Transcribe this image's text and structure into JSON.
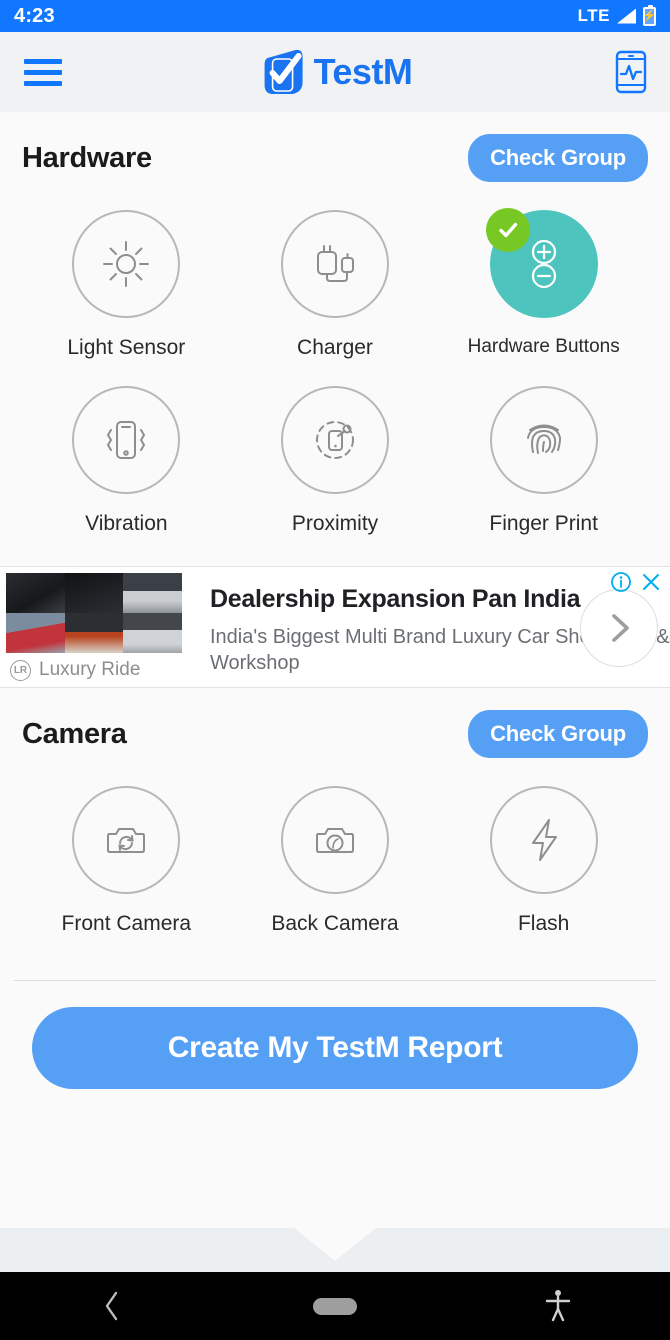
{
  "status_bar": {
    "time": "4:23",
    "network": "LTE",
    "signal_icon": "signal-bars-icon",
    "battery_icon": "battery-charging-icon",
    "background_color": "#1177ff"
  },
  "app_bar": {
    "menu_icon": "hamburger-menu-icon",
    "brand_name": "TestM",
    "brand_color": "#1a73f0",
    "logo_icon": "testm-logo-icon",
    "right_icon": "phone-pulse-icon"
  },
  "sections": [
    {
      "title": "Hardware",
      "action_label": "Check Group",
      "tiles": [
        {
          "label": "Light Sensor",
          "icon": "sun-light-sensor-icon",
          "state": "untested"
        },
        {
          "label": "Charger",
          "icon": "charger-plug-icon",
          "state": "untested"
        },
        {
          "label": "Hardware Buttons",
          "icon": "volume-buttons-icon",
          "state": "passed"
        },
        {
          "label": "Vibration",
          "icon": "phone-vibration-icon",
          "state": "untested"
        },
        {
          "label": "Proximity",
          "icon": "proximity-sensor-icon",
          "state": "untested"
        },
        {
          "label": "Finger Print",
          "icon": "fingerprint-icon",
          "state": "untested"
        }
      ]
    },
    {
      "title": "Camera",
      "action_label": "Check Group",
      "tiles": [
        {
          "label": "Front Camera",
          "icon": "camera-rotate-icon",
          "state": "untested"
        },
        {
          "label": "Back Camera",
          "icon": "camera-icon",
          "state": "untested"
        },
        {
          "label": "Flash",
          "icon": "flash-bolt-icon",
          "state": "untested"
        }
      ]
    }
  ],
  "advertisement": {
    "headline": "Dealership Expansion Pan India",
    "description": "India's Biggest Multi Brand Luxury Car Showroom & Workshop",
    "advertiser": "Luxury Ride",
    "info_icon": "ad-info-icon",
    "close_icon": "ad-close-icon",
    "next_icon": "chevron-right-icon",
    "thumbnail": "car-showroom-collage"
  },
  "cta": {
    "label": "Create My TestM Report",
    "color": "#559ff5"
  },
  "nav_bar": {
    "back_icon": "back-chevron-icon",
    "home_icon": "home-pill-icon",
    "accessibility_icon": "accessibility-icon"
  },
  "colors": {
    "accent_blue": "#1177ff",
    "button_blue": "#559ff5",
    "passed_teal": "#4ec4be",
    "badge_green": "#77c825",
    "icon_outline": "#b7b7b7"
  }
}
